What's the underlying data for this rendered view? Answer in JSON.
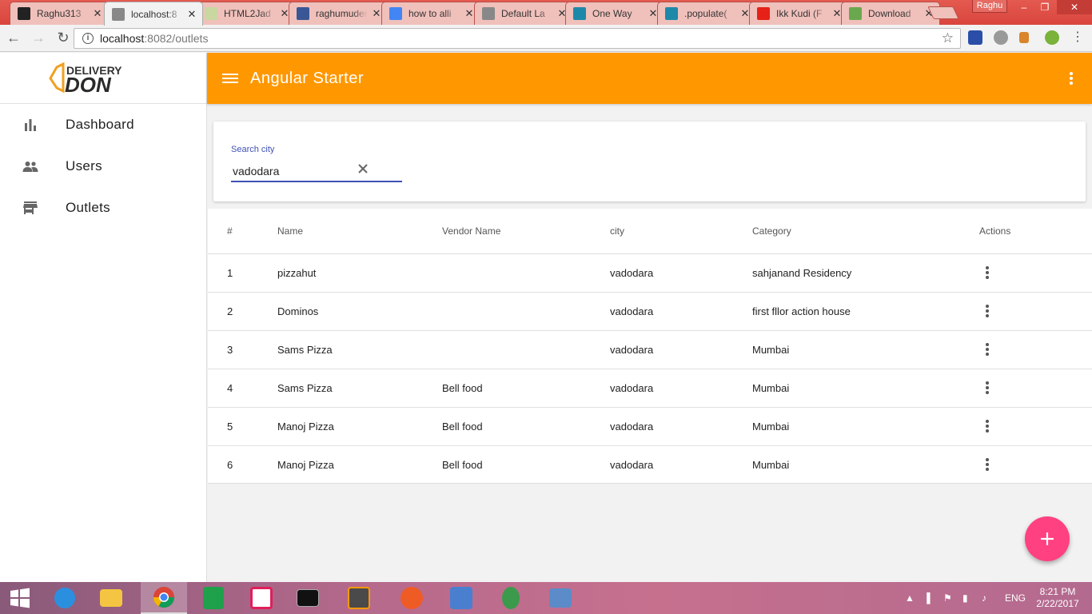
{
  "browser": {
    "tabs": [
      {
        "title": "Raghu313",
        "favicon": "github-icon",
        "color": "#222222"
      },
      {
        "title": "localhost:8",
        "favicon": "page-icon",
        "color": "#888888",
        "active": true
      },
      {
        "title": "HTML2Jad",
        "favicon": "html2jade-icon",
        "color": "#c8d8a0"
      },
      {
        "title": "raghumudem",
        "favicon": "bitbucket-icon",
        "color": "#3a5795"
      },
      {
        "title": "how to alli",
        "favicon": "google-icon",
        "color": "#4285f4"
      },
      {
        "title": "Default La",
        "favicon": "page-icon",
        "color": "#888888"
      },
      {
        "title": "One Way",
        "favicon": "sails-icon",
        "color": "#1e88a8"
      },
      {
        "title": ".populate(",
        "favicon": "sails-icon",
        "color": "#1e88a8"
      },
      {
        "title": "Ikk Kudi (F",
        "favicon": "youtube-icon",
        "color": "#e62117"
      },
      {
        "title": "Download",
        "favicon": "apkpure-icon",
        "color": "#6aa84f"
      }
    ],
    "profile_name": "Raghu",
    "url_host": "localhost",
    "url_path": ":8082/outlets"
  },
  "sidebar": {
    "logo_top": "DELIVERY",
    "logo_bottom": "DON",
    "items": [
      {
        "label": "Dashboard",
        "icon": "bar-chart-icon"
      },
      {
        "label": "Users",
        "icon": "people-icon"
      },
      {
        "label": "Outlets",
        "icon": "store-icon"
      }
    ]
  },
  "header": {
    "title": "Angular Starter",
    "color": "#ff9800"
  },
  "search": {
    "label": "Search city",
    "value": "vadodara"
  },
  "table": {
    "columns": [
      "#",
      "Name",
      "Vendor Name",
      "city",
      "Category",
      "Actions"
    ],
    "rows": [
      {
        "num": "1",
        "name": "pizzahut",
        "vendor": "",
        "city": "vadodara",
        "category": "sahjanand Residency"
      },
      {
        "num": "2",
        "name": "Dominos",
        "vendor": "",
        "city": "vadodara",
        "category": "first fllor action house"
      },
      {
        "num": "3",
        "name": "Sams Pizza",
        "vendor": "",
        "city": "vadodara",
        "category": "Mumbai"
      },
      {
        "num": "4",
        "name": "Sams Pizza",
        "vendor": "Bell food",
        "city": "vadodara",
        "category": "Mumbai"
      },
      {
        "num": "5",
        "name": "Manoj Pizza",
        "vendor": "Bell food",
        "city": "vadodara",
        "category": "Mumbai"
      },
      {
        "num": "6",
        "name": "Manoj Pizza",
        "vendor": "Bell food",
        "city": "vadodara",
        "category": "Mumbai"
      }
    ]
  },
  "fab": {
    "icon": "plus-icon",
    "color": "#ff4081"
  },
  "taskbar": {
    "language": "ENG",
    "time": "8:21 PM",
    "date": "2/22/2017"
  }
}
